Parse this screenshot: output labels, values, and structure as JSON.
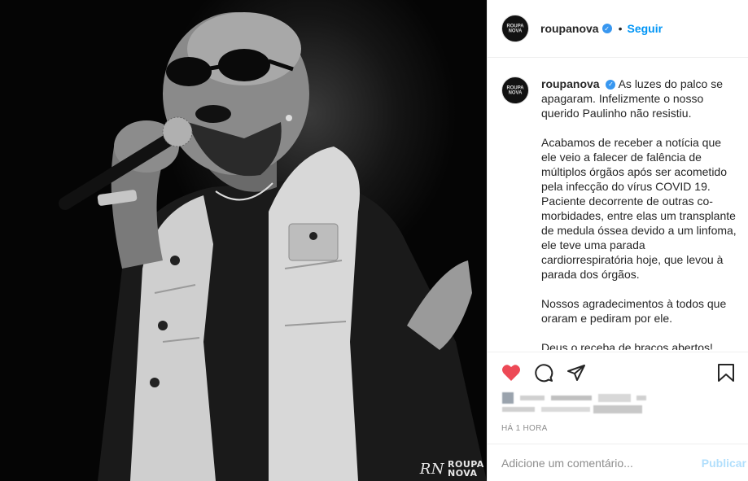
{
  "post": {
    "account": {
      "username": "roupanova",
      "verified": true,
      "avatar_text": "ROUPA NOVA",
      "follow_label": "Seguir",
      "separator": "•"
    },
    "image": {
      "watermark": "ROUPA NOVA",
      "watermark_mark": "RN",
      "description_icon": "singer-with-microphone-photo"
    },
    "caption": {
      "lead": "As luzes do palco se apagaram. Infelizmente o nosso querido Paulinho não resistiu.",
      "paragraphs": [
        "Acabamos de receber a notícia que ele veio a falecer de falência de múltiplos órgãos após ser acometido pela infecção do vírus COVID 19. Paciente decorrente de outras co-morbidades, entre elas um transplante de medula óssea devido a um linfoma, ele teve uma parada cardiorrespiratória hoje, que levou à parada dos órgãos.",
        "Nossos agradecimentos à todos que oraram e pediram por ele.",
        "Deus o receba de braços abertos!"
      ]
    },
    "actions": {
      "like_icon": "heart-filled-icon",
      "comment_icon": "comment-icon",
      "share_icon": "paper-plane-icon",
      "save_icon": "bookmark-icon",
      "like_color": "#ed4956"
    },
    "timestamp": "HÁ 1 HORA",
    "comment": {
      "placeholder": "Adicione um comentário...",
      "publish_label": "Publicar"
    }
  },
  "colors": {
    "accent": "#0095f6",
    "publish_disabled": "#b2dffc",
    "muted": "#8e8e8e",
    "border": "#efefef"
  }
}
